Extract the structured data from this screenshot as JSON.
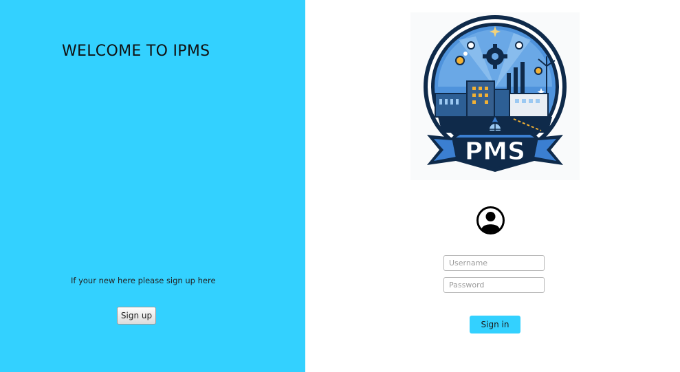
{
  "colors": {
    "left_panel_bg": "#33d1ff",
    "signin_button_bg": "#33d1ff",
    "logo_navy": "#0f2a4a",
    "logo_blue": "#3b7fd1"
  },
  "left_panel": {
    "welcome_title": "WELCOME TO IPMS",
    "signup_hint": "If your new here please sign up here",
    "signup_label": "Sign up"
  },
  "right_panel": {
    "logo": {
      "icon": "factory-logo-icon",
      "text": "PMS"
    },
    "user_icon": "user-avatar-icon",
    "username": {
      "value": "",
      "placeholder": "Username"
    },
    "password": {
      "value": "",
      "placeholder": "Password"
    },
    "signin_label": "Sign in"
  }
}
